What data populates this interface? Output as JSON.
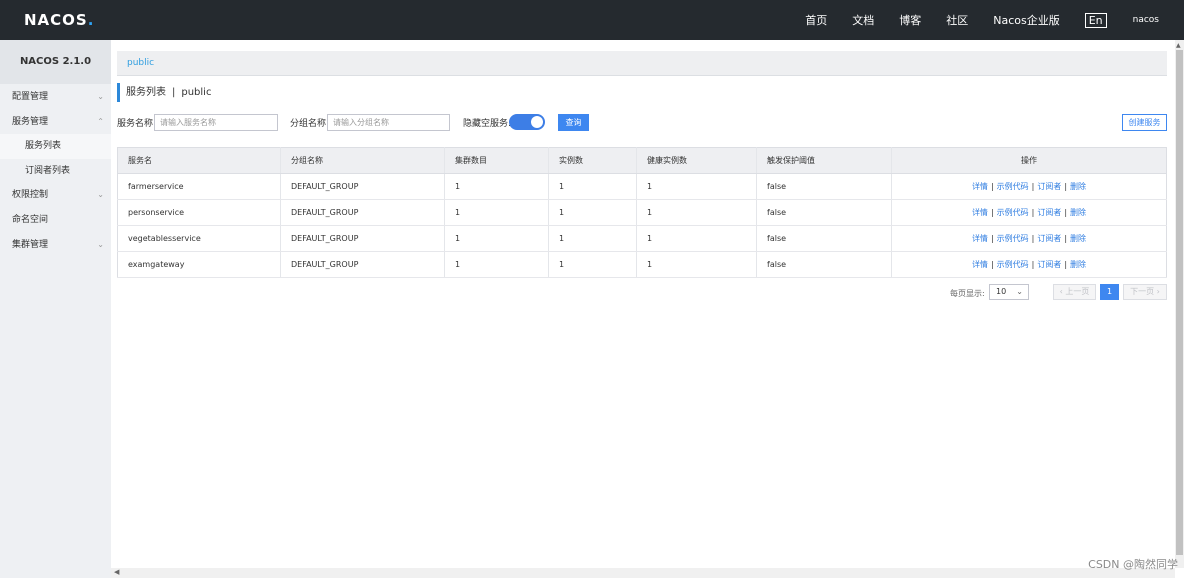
{
  "topbar": {
    "logo": "NACOS",
    "logo_dot": ".",
    "nav": [
      "首页",
      "文档",
      "博客",
      "社区",
      "Nacos企业版"
    ],
    "lang": "En",
    "user": "nacos"
  },
  "sidebar": {
    "title": "NACOS 2.1.0",
    "items": [
      {
        "label": "配置管理"
      },
      {
        "label": "服务管理"
      },
      {
        "label": "服务列表"
      },
      {
        "label": "订阅者列表"
      },
      {
        "label": "权限控制"
      },
      {
        "label": "命名空间"
      },
      {
        "label": "集群管理"
      }
    ]
  },
  "breadcrumb": {
    "namespace": "public"
  },
  "page": {
    "title": "服务列表",
    "separator": "|",
    "namespace": "public"
  },
  "filters": {
    "service_label": "服务名称",
    "service_placeholder": "请输入服务名称",
    "group_label": "分组名称",
    "group_placeholder": "请输入分组名称",
    "hide_empty_label": "隐藏空服务:",
    "query_button": "查询",
    "create_button": "创建服务"
  },
  "table": {
    "headers": [
      "服务名",
      "分组名称",
      "集群数目",
      "实例数",
      "健康实例数",
      "触发保护阈值",
      "操作"
    ],
    "rows": [
      [
        "farmerservice",
        "DEFAULT_GROUP",
        "1",
        "1",
        "1",
        "false"
      ],
      [
        "personservice",
        "DEFAULT_GROUP",
        "1",
        "1",
        "1",
        "false"
      ],
      [
        "vegetablesservice",
        "DEFAULT_GROUP",
        "1",
        "1",
        "1",
        "false"
      ],
      [
        "examgateway",
        "DEFAULT_GROUP",
        "1",
        "1",
        "1",
        "false"
      ]
    ],
    "ops": {
      "detail": "详情",
      "sample": "示例代码",
      "subscribers": "订阅者",
      "delete": "删除",
      "sep": "|"
    }
  },
  "pager": {
    "per_page_label": "每页显示:",
    "per_page": "10",
    "prev": "上一页",
    "current": "1",
    "next": "下一页"
  },
  "watermark": "CSDN @陶然同学",
  "colors": {
    "topbar": "#252a2f",
    "accent": "#3e87f0",
    "link": "#2f7de1"
  }
}
